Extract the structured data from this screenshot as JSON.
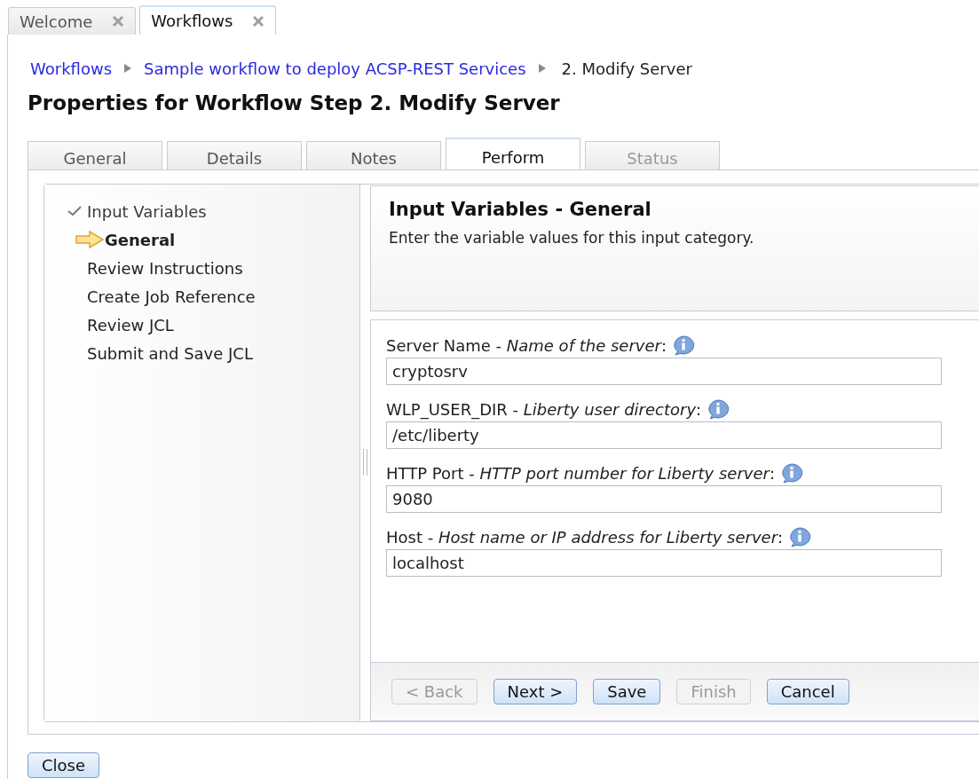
{
  "editor_tabs": [
    {
      "label": "Welcome",
      "selected": false
    },
    {
      "label": "Workflows",
      "selected": true
    }
  ],
  "breadcrumb": [
    {
      "label": "Workflows",
      "link": true
    },
    {
      "label": "Sample workflow to deploy ACSP-REST Services",
      "link": true
    },
    {
      "label": "2. Modify Server",
      "link": false
    }
  ],
  "title": "Properties for Workflow Step 2. Modify Server",
  "tabs": [
    {
      "label": "General",
      "selected": false,
      "disabled": false
    },
    {
      "label": "Details",
      "selected": false,
      "disabled": false
    },
    {
      "label": "Notes",
      "selected": false,
      "disabled": false
    },
    {
      "label": "Perform",
      "selected": true,
      "disabled": false
    },
    {
      "label": "Status",
      "selected": false,
      "disabled": true
    }
  ],
  "steps": [
    {
      "label": "Input Variables",
      "completed": true,
      "current": false,
      "children": [
        {
          "label": "General",
          "completed": false,
          "current": true
        }
      ]
    },
    {
      "label": "Review Instructions",
      "completed": false,
      "current": false
    },
    {
      "label": "Create Job Reference",
      "completed": false,
      "current": false
    },
    {
      "label": "Review JCL",
      "completed": false,
      "current": false
    },
    {
      "label": "Submit and Save JCL",
      "completed": false,
      "current": false
    }
  ],
  "section": {
    "title": "Input Variables - General",
    "description": "Enter the variable values for this input category."
  },
  "fields": [
    {
      "label": "Server Name - *Name of the server*:",
      "value": "cryptosrv"
    },
    {
      "label": "WLP_USER_DIR - *Liberty user directory*:",
      "value": "/etc/liberty"
    },
    {
      "label": "HTTP Port - *HTTP port number for Liberty server*:",
      "value": "9080"
    },
    {
      "label": "Host - *Host name or IP address for Liberty server*:",
      "value": "localhost"
    }
  ],
  "buttons": [
    {
      "label": "< Back",
      "disabled": true
    },
    {
      "label": "Next >",
      "disabled": false
    },
    {
      "label": "Save",
      "disabled": false
    },
    {
      "label": "Finish",
      "disabled": true
    },
    {
      "label": "Cancel",
      "disabled": false
    }
  ],
  "close_button": "Close"
}
